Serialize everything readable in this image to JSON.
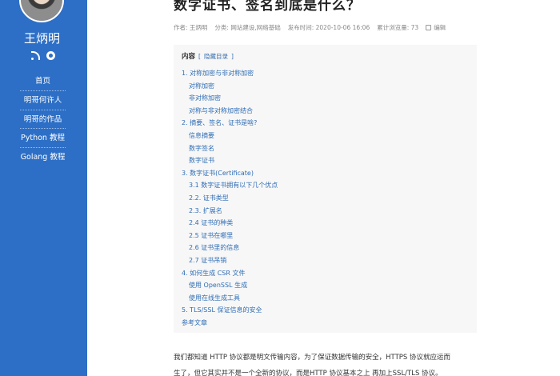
{
  "sidebar": {
    "site_name": "王炳明",
    "nav": [
      "首页",
      "明哥何许人",
      "明哥的作品",
      "Python 教程",
      "Golang 教程"
    ]
  },
  "article": {
    "title": "数字证书、签名到底是什么？",
    "meta": {
      "author": "作者: 王炳明",
      "category": "分类: 网站建设,网络基础",
      "published": "发布时间: 2020-10-06 16:06",
      "views": "累计浏览量: 73",
      "edit": "编辑"
    },
    "toc": {
      "title": "内容",
      "bracket_open": "[",
      "toggle": "隐藏目录",
      "bracket_close": "]",
      "items": [
        {
          "text": "1. 对称加密与非对称加密",
          "level": 1
        },
        {
          "text": "对称加密",
          "level": 2
        },
        {
          "text": "非对称加密",
          "level": 2
        },
        {
          "text": "对称与非对称加密结合",
          "level": 2
        },
        {
          "text": "2. 摘要、签名、证书是啥?",
          "level": 1
        },
        {
          "text": "信息摘要",
          "level": 2
        },
        {
          "text": "数字签名",
          "level": 2
        },
        {
          "text": "数字证书",
          "level": 2
        },
        {
          "text": "3. 数字证书(Certificate)",
          "level": 1
        },
        {
          "text": "3.1 数字证书拥有以下几个优点",
          "level": 2
        },
        {
          "text": "2.2. 证书类型",
          "level": 2
        },
        {
          "text": "2.3. 扩展名",
          "level": 2
        },
        {
          "text": "2.4 证书的种类",
          "level": 2
        },
        {
          "text": "2.5 证书在哪里",
          "level": 2
        },
        {
          "text": "2.6 证书里的信息",
          "level": 2
        },
        {
          "text": "2.7 证书吊销",
          "level": 2
        },
        {
          "text": "4. 如何生成 CSR 文件",
          "level": 1
        },
        {
          "text": "使用 OpenSSL 生成",
          "level": 2
        },
        {
          "text": "使用在线生成工具",
          "level": 2
        },
        {
          "text": "5. TLS/SSL 保证信息的安全",
          "level": 1
        },
        {
          "text": "参考文章",
          "level": 1
        }
      ]
    },
    "body": [
      "我们都知道 HTTP 协议都是明文传输内容，为了保证数据传输的安全，HTTPS 协议就应运而",
      "生了，但它其实并不是一个全新的协议，而是HTTP 协议基本之上 再加上SSL/TLS 协议。"
    ]
  }
}
